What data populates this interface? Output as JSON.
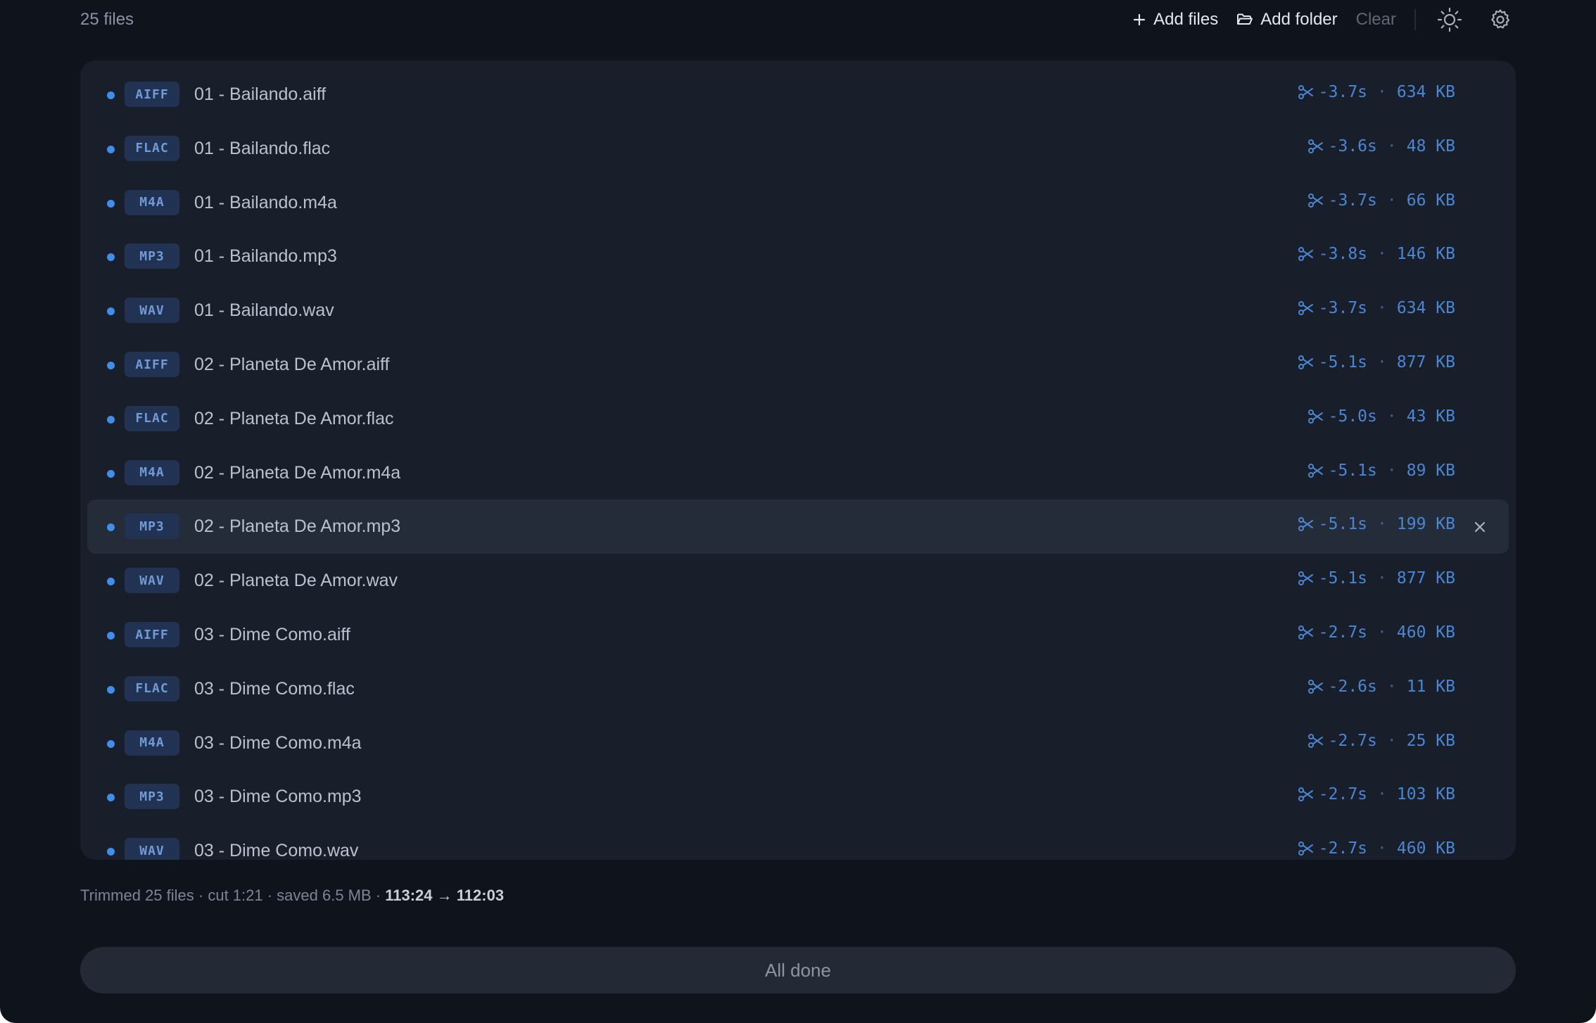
{
  "header": {
    "file_count": "25 files",
    "add_files_label": "Add files",
    "add_folder_label": "Add folder",
    "clear_label": "Clear",
    "theme_icon": "sun-icon",
    "settings_icon": "gear-icon"
  },
  "files": [
    {
      "format": "AIFF",
      "name": "01 - Bailando.aiff",
      "trim": "-3.7s",
      "size": "634 KB"
    },
    {
      "format": "FLAC",
      "name": "01 - Bailando.flac",
      "trim": "-3.6s",
      "size": "48 KB"
    },
    {
      "format": "M4A",
      "name": "01 - Bailando.m4a",
      "trim": "-3.7s",
      "size": "66 KB"
    },
    {
      "format": "MP3",
      "name": "01 - Bailando.mp3",
      "trim": "-3.8s",
      "size": "146 KB"
    },
    {
      "format": "WAV",
      "name": "01 - Bailando.wav",
      "trim": "-3.7s",
      "size": "634 KB"
    },
    {
      "format": "AIFF",
      "name": "02 - Planeta De Amor.aiff",
      "trim": "-5.1s",
      "size": "877 KB"
    },
    {
      "format": "FLAC",
      "name": "02 - Planeta De Amor.flac",
      "trim": "-5.0s",
      "size": "43 KB"
    },
    {
      "format": "M4A",
      "name": "02 - Planeta De Amor.m4a",
      "trim": "-5.1s",
      "size": "89 KB"
    },
    {
      "format": "MP3",
      "name": "02 - Planeta De Amor.mp3",
      "trim": "-5.1s",
      "size": "199 KB",
      "hovered": true
    },
    {
      "format": "WAV",
      "name": "02 - Planeta De Amor.wav",
      "trim": "-5.1s",
      "size": "877 KB"
    },
    {
      "format": "AIFF",
      "name": "03 - Dime Como.aiff",
      "trim": "-2.7s",
      "size": "460 KB"
    },
    {
      "format": "FLAC",
      "name": "03 - Dime Como.flac",
      "trim": "-2.6s",
      "size": "11 KB"
    },
    {
      "format": "M4A",
      "name": "03 - Dime Como.m4a",
      "trim": "-2.7s",
      "size": "25 KB"
    },
    {
      "format": "MP3",
      "name": "03 - Dime Como.mp3",
      "trim": "-2.7s",
      "size": "103 KB"
    },
    {
      "format": "WAV",
      "name": "03 - Dime Como.wav",
      "trim": "-2.7s",
      "size": "460 KB"
    }
  ],
  "meta_separator": "·",
  "summary": {
    "prefix": "Trimmed 25 files · cut 1:21 · saved 6.5 MB · ",
    "duration_before": "113:24",
    "arrow": "→",
    "duration_after": "112:03"
  },
  "done_button": {
    "label": "All done"
  },
  "colors": {
    "background": "#0f131b",
    "panel": "#181e2a",
    "accent": "#3f8ee9",
    "badge_bg": "#223252",
    "badge_text": "#6f9bd8"
  }
}
